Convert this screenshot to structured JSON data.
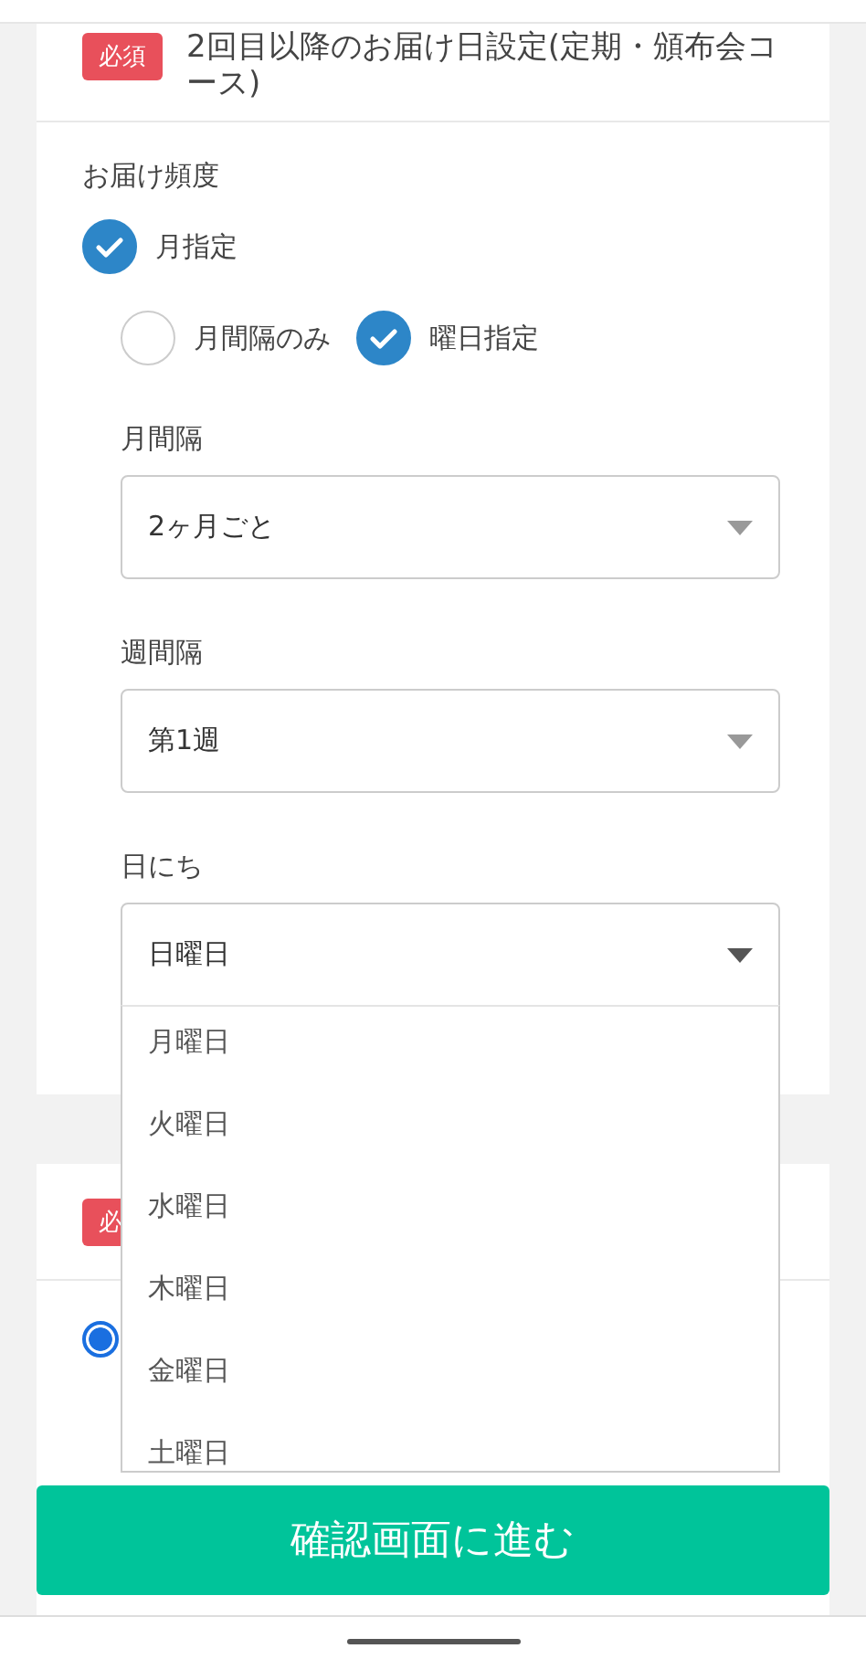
{
  "delivery_section": {
    "badge": "必須",
    "title": "2回目以降のお届け日設定(定期・頒布会コース)",
    "frequency_label": "お届け頻度",
    "mode": {
      "label": "月指定",
      "checked": true
    },
    "sub_options": [
      {
        "label": "月間隔のみ",
        "selected": false
      },
      {
        "label": "曜日指定",
        "selected": true
      }
    ],
    "selects": [
      {
        "label": "月間隔",
        "value": "2ヶ月ごと",
        "expanded": false
      },
      {
        "label": "週間隔",
        "value": "第1週",
        "expanded": false
      },
      {
        "label": "日にち",
        "value": "日曜日",
        "expanded": true,
        "options": [
          "月曜日",
          "火曜日",
          "水曜日",
          "木曜日",
          "金曜日",
          "土曜日"
        ]
      }
    ]
  },
  "next_section": {
    "badge": "必",
    "radio_selected": true
  },
  "confirm_button": "確認画面に進む"
}
